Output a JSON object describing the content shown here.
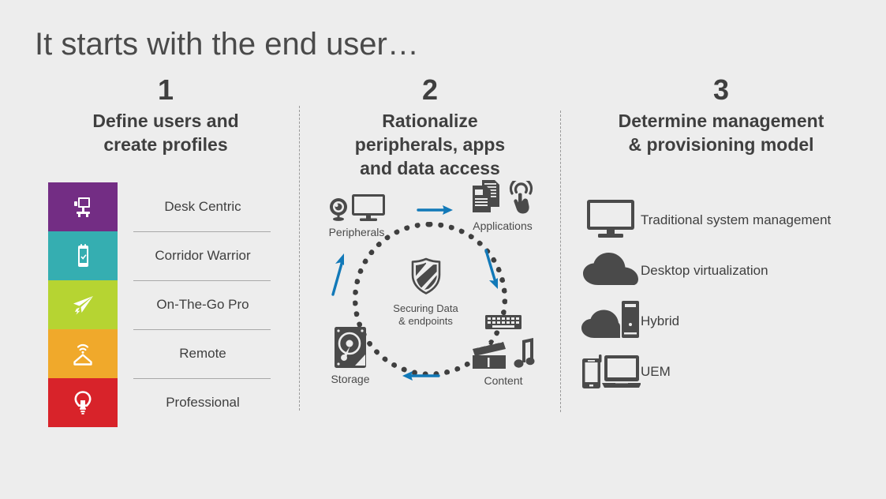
{
  "slide": {
    "title": "It starts with the end user…",
    "background_color": "#ededed",
    "text_color": "#3f3f3f",
    "accent_blue": "#1279b8",
    "icon_gray": "#4a4a4a"
  },
  "columns": [
    {
      "number": "1",
      "heading_line_1": "Define users and",
      "heading_line_2": "create profiles",
      "personas": [
        {
          "label": "Desk Centric",
          "color": "#732d84",
          "icon": "desk-workstation-icon"
        },
        {
          "label": "Corridor Warrior",
          "color": "#35aeb1",
          "icon": "tablet-check-icon"
        },
        {
          "label": "On-The-Go Pro",
          "color": "#b6d432",
          "icon": "paper-plane-icon"
        },
        {
          "label": "Remote",
          "color": "#f0a92b",
          "icon": "home-wifi-icon"
        },
        {
          "label": "Professional",
          "color": "#d8232a",
          "icon": "lightbulb-icon"
        }
      ]
    },
    {
      "number": "2",
      "heading_line_1": "Rationalize",
      "heading_line_2": "peripherals, apps",
      "heading_line_3": "and data access",
      "center": {
        "icon": "shield-icon",
        "label_line_1": "Securing Data",
        "label_line_2": "& endpoints"
      },
      "nodes": [
        {
          "label": "Peripherals",
          "icons": [
            "webcam-icon",
            "monitor-icon"
          ]
        },
        {
          "label": "Applications",
          "icons": [
            "documents-icon",
            "touch-hand-icon"
          ]
        },
        {
          "label": "Content",
          "icons": [
            "keyboard-icon",
            "clapperboard-icon",
            "music-note-icon"
          ]
        },
        {
          "label": "Storage",
          "icons": [
            "hard-drive-icon"
          ]
        }
      ],
      "arrows": [
        "arrow-right-top",
        "arrow-down-right",
        "arrow-left-bottom",
        "arrow-up-left"
      ]
    },
    {
      "number": "3",
      "heading_line_1": "Determine management",
      "heading_line_2": "& provisioning model",
      "models": [
        {
          "label": "Traditional system management",
          "icon": "monitor-icon"
        },
        {
          "label": "Desktop virtualization",
          "icon": "cloud-icon"
        },
        {
          "label": "Hybrid",
          "icon": "cloud-tower-icon"
        },
        {
          "label": "UEM",
          "icon": "phone-laptop-icon"
        }
      ]
    }
  ]
}
